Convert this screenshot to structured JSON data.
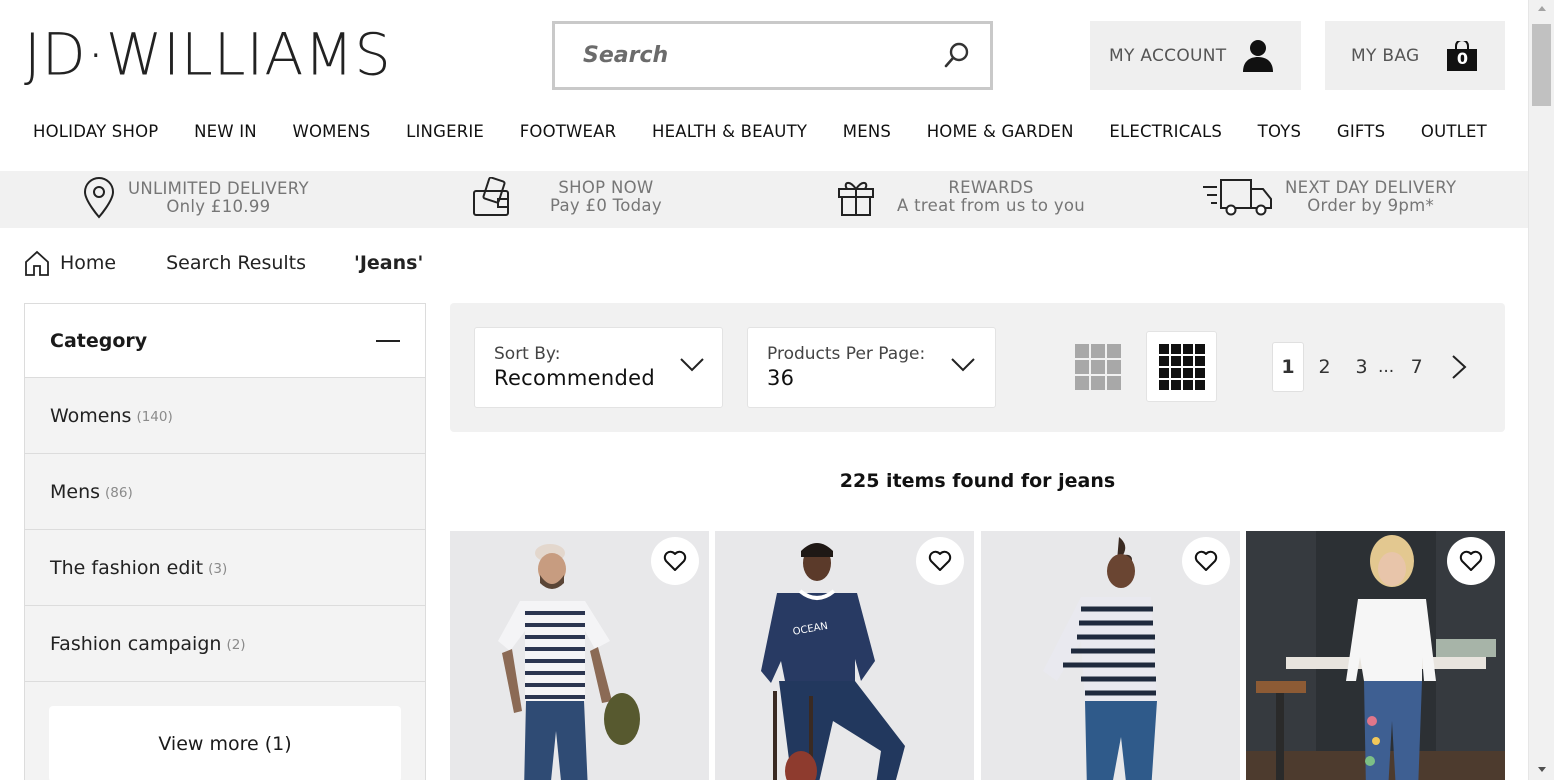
{
  "header": {
    "logo_text": "JD·WILLIAMS",
    "search_placeholder": "Search",
    "account_label": "MY ACCOUNT",
    "bag_label": "MY BAG",
    "bag_count": "0"
  },
  "nav": [
    "HOLIDAY SHOP",
    "NEW IN",
    "WOMENS",
    "LINGERIE",
    "FOOTWEAR",
    "HEALTH & BEAUTY",
    "MENS",
    "HOME & GARDEN",
    "ELECTRICALS",
    "TOYS",
    "GIFTS",
    "OUTLET"
  ],
  "promos": [
    {
      "line1": "UNLIMITED DELIVERY",
      "line2": "Only £10.99",
      "icon": "location-pin-icon"
    },
    {
      "line1": "SHOP NOW",
      "line2": "Pay £0 Today",
      "icon": "wallet-icon"
    },
    {
      "line1": "REWARDS",
      "line2": "A treat from us to you",
      "icon": "gift-icon"
    },
    {
      "line1": "NEXT DAY DELIVERY",
      "line2": "Order by 9pm*",
      "icon": "delivery-truck-icon"
    }
  ],
  "breadcrumb": {
    "home": "Home",
    "search": "Search Results",
    "current": "'Jeans'"
  },
  "sidebar": {
    "title": "Category",
    "items": [
      {
        "name": "Womens",
        "count": "(140)"
      },
      {
        "name": "Mens",
        "count": "(86)"
      },
      {
        "name": "The fashion edit",
        "count": "(3)"
      },
      {
        "name": "Fashion campaign",
        "count": "(2)"
      }
    ],
    "view_more": "View more (1)"
  },
  "toolbar": {
    "sort_label": "Sort By:",
    "sort_value": "Recommended",
    "per_page_label": "Products Per Page:",
    "per_page_value": "36",
    "pages": [
      "1",
      "2",
      "3",
      "7"
    ],
    "ellipsis": "...",
    "current_page": "1"
  },
  "results_text": "225 items found for jeans",
  "colors": {
    "accent": "#111111",
    "promo_bg": "#f1f1f1",
    "panel_bg": "#efefef"
  }
}
